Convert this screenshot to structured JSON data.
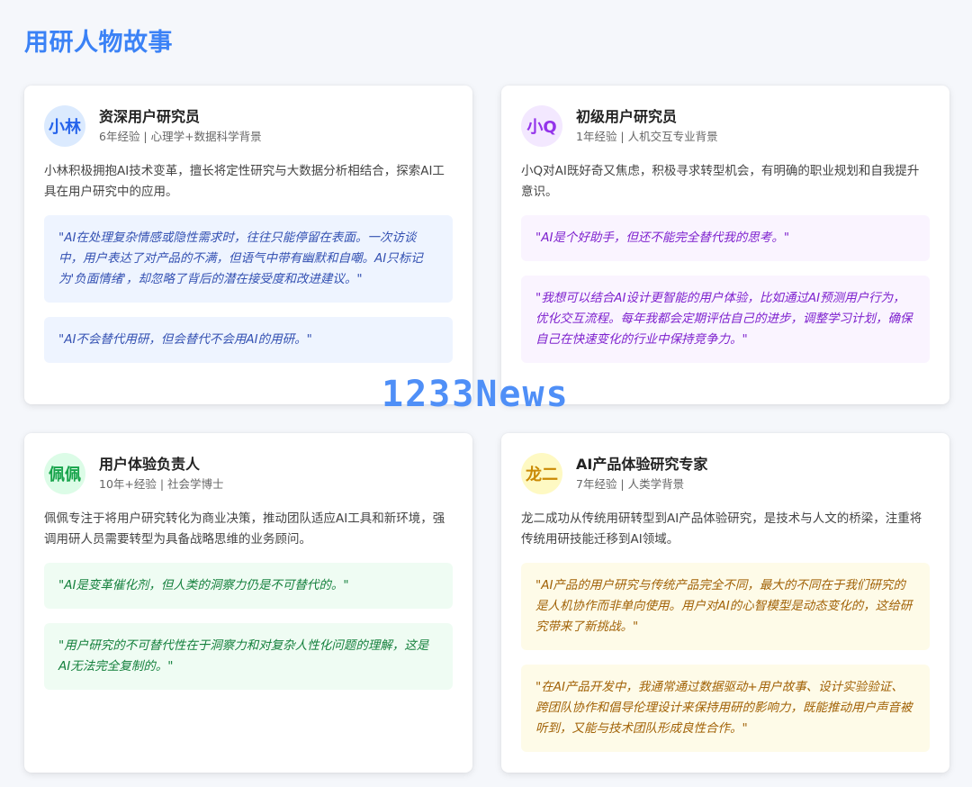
{
  "page": {
    "title": "用研人物故事"
  },
  "watermark": "1233News",
  "colors": {
    "accent": "#3b82f6",
    "blue": "#2563eb",
    "purple": "#9333ea",
    "green": "#16a34a",
    "yellow": "#ca8a04"
  },
  "cards": [
    {
      "avatar": "小林",
      "title": "资深用户研究员",
      "meta": "6年经验 | 心理学+数据科学背景",
      "description": "小林积极拥抱AI技术变革，擅长将定性研究与大数据分析相结合，探索AI工具在用户研究中的应用。",
      "quotes": [
        "\"AI在处理复杂情感或隐性需求时，往往只能停留在表面。一次访谈中，用户表达了对产品的不满，但语气中带有幽默和自嘲。AI只标记为'负面情绪'，却忽略了背后的潜在接受度和改进建议。\"",
        "\"AI不会替代用研，但会替代不会用AI的用研。\""
      ]
    },
    {
      "avatar": "小Q",
      "title": "初级用户研究员",
      "meta": "1年经验 | 人机交互专业背景",
      "description": "小Q对AI既好奇又焦虑，积极寻求转型机会，有明确的职业规划和自我提升意识。",
      "quotes": [
        "\"AI是个好助手，但还不能完全替代我的思考。\"",
        "\"我想可以结合AI设计更智能的用户体验，比如通过AI预测用户行为，优化交互流程。每年我都会定期评估自己的进步，调整学习计划，确保自己在快速变化的行业中保持竞争力。\""
      ]
    },
    {
      "avatar": "佩佩",
      "title": "用户体验负责人",
      "meta": "10年+经验 | 社会学博士",
      "description": "佩佩专注于将用户研究转化为商业决策，推动团队适应AI工具和新环境，强调用研人员需要转型为具备战略思维的业务顾问。",
      "quotes": [
        "\"AI是变革催化剂，但人类的洞察力仍是不可替代的。\"",
        "\"用户研究的不可替代性在于洞察力和对复杂人性化问题的理解，这是AI无法完全复制的。\""
      ]
    },
    {
      "avatar": "龙二",
      "title": "AI产品体验研究专家",
      "meta": "7年经验 | 人类学背景",
      "description": "龙二成功从传统用研转型到AI产品体验研究，是技术与人文的桥梁，注重将传统用研技能迁移到AI领域。",
      "quotes": [
        "\"AI产品的用户研究与传统产品完全不同，最大的不同在于我们研究的是人机协作而非单向使用。用户对AI的心智模型是动态变化的，这给研究带来了新挑战。\"",
        "\"在AI产品开发中，我通常通过数据驱动+用户故事、设计实验验证、跨团队协作和倡导伦理设计来保持用研的影响力，既能推动用户声音被听到，又能与技术团队形成良性合作。\""
      ]
    }
  ]
}
